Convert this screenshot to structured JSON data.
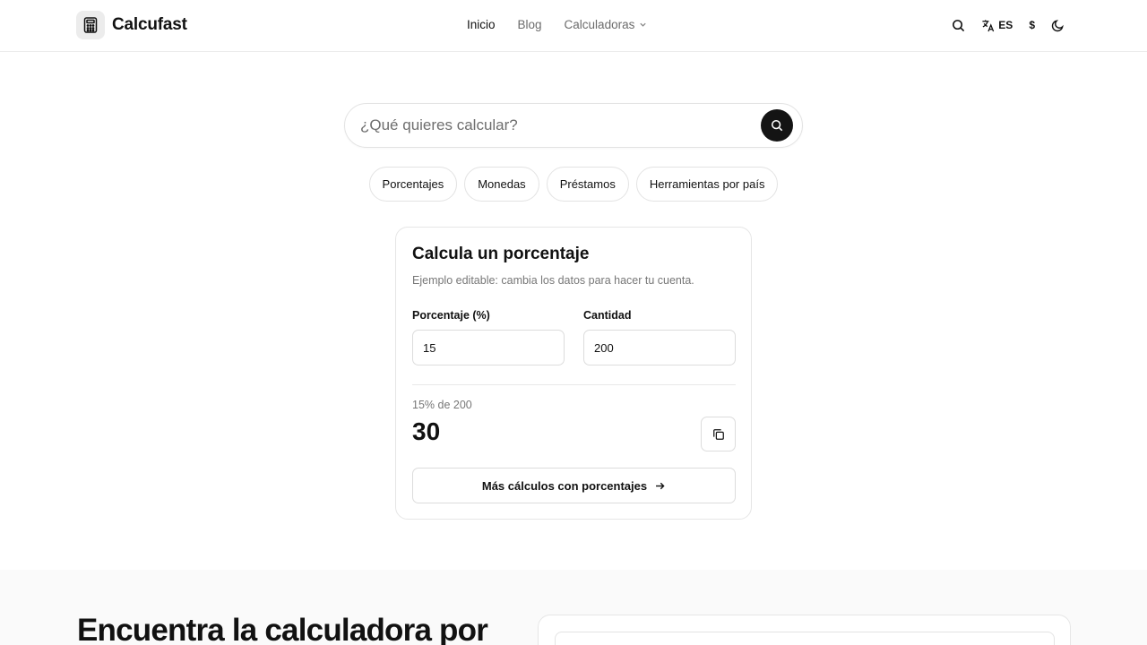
{
  "header": {
    "brand": "Calcufast",
    "nav": [
      {
        "label": "Inicio",
        "active": true
      },
      {
        "label": "Blog",
        "active": false
      },
      {
        "label": "Calculadoras",
        "active": false
      }
    ],
    "language": "ES",
    "currency": "$"
  },
  "search": {
    "placeholder": "¿Qué quieres calcular?"
  },
  "chips": [
    "Porcentajes",
    "Monedas",
    "Préstamos",
    "Herramientas por país"
  ],
  "card": {
    "title": "Calcula un porcentaje",
    "subtitle": "Ejemplo editable: cambia los datos para hacer tu cuenta.",
    "percent_label": "Porcentaje (%)",
    "percent_value": "15",
    "amount_label": "Cantidad",
    "amount_value": "200",
    "result_label": "15% de 200",
    "result_value": "30",
    "more_label": "Más cálculos con porcentajes"
  },
  "bottom": {
    "title": "Encuentra la calculadora por"
  },
  "icons": {
    "logo": "calculator-icon",
    "search": "search-icon",
    "language": "translate-icon",
    "theme": "moon-icon",
    "copy": "copy-icon",
    "arrow": "arrow-right-icon"
  }
}
